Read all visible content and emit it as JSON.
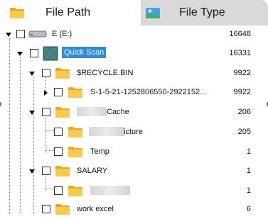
{
  "tabs": [
    {
      "label": "File Path",
      "icon": "folder-icon",
      "active": true
    },
    {
      "label": "File Type",
      "icon": "image-icon",
      "active": false
    }
  ],
  "tree": {
    "rows": [
      {
        "label": "E (E:)",
        "count": "16648",
        "icon": "drive-icon"
      },
      {
        "label": "Quick Scan",
        "count": "16331",
        "icon": "quick-scan-icon",
        "selected": true
      },
      {
        "label": "$RECYCLE.BIN",
        "count": "9922",
        "icon": "folder-icon"
      },
      {
        "label": "S-1-5-21-1252806550-2922152...",
        "count": "9922",
        "icon": "folder-icon"
      },
      {
        "label": "Cache",
        "count": "206",
        "icon": "folder-icon",
        "obscured_prefix": true
      },
      {
        "label": "icture",
        "count": "205",
        "icon": "folder-icon",
        "obscured_prefix": true
      },
      {
        "label": "Temp",
        "count": "1",
        "icon": "folder-icon"
      },
      {
        "label": "SALARY",
        "count": "1",
        "icon": "folder-icon"
      },
      {
        "label": "",
        "count": "1",
        "icon": "folder-icon",
        "obscured_prefix": true
      },
      {
        "label": "work excel",
        "count": "6",
        "icon": "folder-icon"
      }
    ]
  },
  "colors": {
    "selection": "#2f8ae3",
    "folder": "#f7c23c",
    "tab_inactive": "#d9d9d9"
  }
}
